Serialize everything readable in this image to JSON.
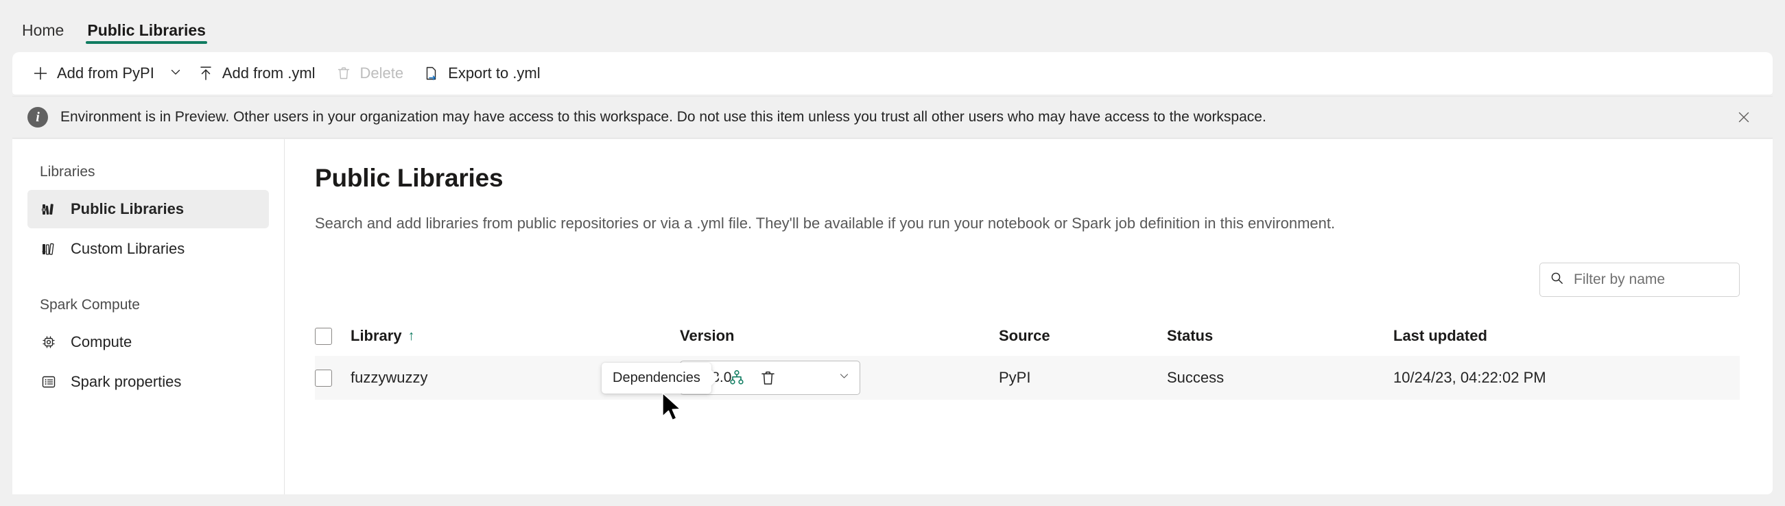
{
  "tabs": [
    {
      "label": "Home",
      "selected": false
    },
    {
      "label": "Public Libraries",
      "selected": true
    }
  ],
  "toolbar": {
    "add_from_pypi": "Add from PyPI",
    "add_from_yml": "Add from .yml",
    "delete": "Delete",
    "export_to_yml": "Export to .yml"
  },
  "banner": {
    "message": "Environment is in Preview. Other users in your organization may have access to this workspace. Do not use this item unless you trust all other users who may have access to the workspace.",
    "info_glyph": "i",
    "close_glyph": "✕"
  },
  "sidebar": {
    "groups": [
      {
        "title": "Libraries",
        "items": [
          {
            "label": "Public Libraries",
            "icon": "public-libraries-icon",
            "active": true
          },
          {
            "label": "Custom Libraries",
            "icon": "custom-libraries-icon",
            "active": false
          }
        ]
      },
      {
        "title": "Spark Compute",
        "items": [
          {
            "label": "Compute",
            "icon": "compute-icon",
            "active": false
          },
          {
            "label": "Spark properties",
            "icon": "spark-properties-icon",
            "active": false
          }
        ]
      }
    ]
  },
  "main": {
    "title": "Public Libraries",
    "description": "Search and add libraries from public repositories or via a .yml file. They'll be available if you run your notebook or Spark job definition in this environment."
  },
  "search": {
    "placeholder": "Filter by name",
    "value": ""
  },
  "table": {
    "columns": [
      {
        "key": "library",
        "label": "Library",
        "sort": "asc",
        "sort_glyph": "↑"
      },
      {
        "key": "version",
        "label": "Version"
      },
      {
        "key": "source",
        "label": "Source"
      },
      {
        "key": "status",
        "label": "Status"
      },
      {
        "key": "last_updated",
        "label": "Last updated"
      }
    ],
    "rows": [
      {
        "library": "fuzzywuzzy",
        "version": "0.18.0",
        "source": "PyPI",
        "status": "Success",
        "last_updated": "10/24/23, 04:22:02 PM",
        "selected": false
      }
    ]
  },
  "tooltip": {
    "text": "Dependencies"
  },
  "row_actions": {
    "dependencies_label": "Dependencies",
    "delete_label": "Delete"
  },
  "colors": {
    "accent": "#107c61",
    "page_bg": "#f0f0f0",
    "surface": "#ffffff",
    "row_bg": "#f7f7f7",
    "text": "#242424",
    "muted_text": "#585858",
    "disabled_text": "#bdbdbd"
  }
}
